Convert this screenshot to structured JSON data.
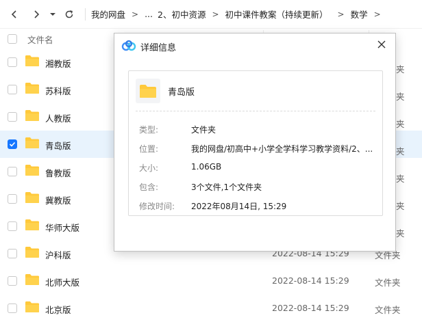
{
  "toolbar": {
    "breadcrumbs": [
      "我的网盘",
      "...",
      "2、初中资源",
      "初中课件教案（持续更新）",
      "数学"
    ]
  },
  "list": {
    "header_name": "文件名",
    "rows": [
      {
        "name": "湘教版",
        "date": "",
        "type": ""
      },
      {
        "name": "苏科版",
        "date": "",
        "type": ""
      },
      {
        "name": "人教版",
        "date": "",
        "type": ""
      },
      {
        "name": "青岛版",
        "date": "",
        "type": "",
        "selected": true
      },
      {
        "name": "鲁教版",
        "date": "",
        "type": ""
      },
      {
        "name": "冀教版",
        "date": "",
        "type": ""
      },
      {
        "name": "华师大版",
        "date": "",
        "type": ""
      },
      {
        "name": "沪科版",
        "date": "2022-08-14 15:29",
        "type": "文件夹"
      },
      {
        "name": "北师大版",
        "date": "2022-08-14 15:29",
        "type": "文件夹"
      },
      {
        "name": "北京版",
        "date": "2022-08-14 15:29",
        "type": "文件夹"
      }
    ],
    "peek_types": [
      "夹",
      "夹",
      "夹",
      "夹",
      "夹",
      "夹",
      "夹"
    ]
  },
  "dialog": {
    "title": "详细信息",
    "file_name": "青岛版",
    "props": [
      {
        "label": "类型:",
        "value": "文件夹"
      },
      {
        "label": "位置:",
        "value": "我的网盘/初高中+小学全学科学习教学资料/2、..."
      },
      {
        "label": "大小:",
        "value": "1.06GB"
      },
      {
        "label": "包含:",
        "value": "3个文件,1个文件夹"
      },
      {
        "label": "修改时间:",
        "value": "2022年08月14日, 15:29"
      }
    ]
  },
  "colors": {
    "accent": "#1677ff",
    "selected_row": "#e8f3fd",
    "folder": "#ffc93b"
  }
}
